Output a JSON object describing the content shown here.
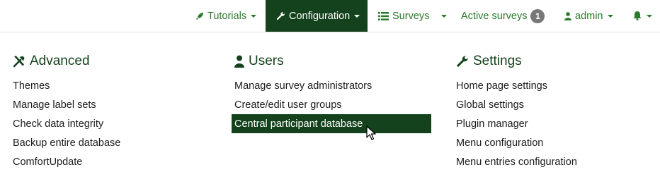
{
  "navbar": {
    "tutorials": {
      "label": "Tutorials",
      "icon": "rocket-icon"
    },
    "configuration": {
      "label": "Configuration",
      "icon": "wrench-icon",
      "active": true
    },
    "surveys": {
      "label": "Surveys",
      "icon": "list-icon"
    },
    "active_surveys": {
      "label": "Active surveys",
      "count": "1"
    },
    "admin": {
      "label": "admin",
      "icon": "user-icon"
    },
    "notifications": {
      "icon": "bell-icon"
    }
  },
  "dropdown": {
    "advanced": {
      "title": "Advanced",
      "icon": "tools-icon",
      "items": [
        "Themes",
        "Manage label sets",
        "Check data integrity",
        "Backup entire database",
        "ComfortUpdate"
      ]
    },
    "users": {
      "title": "Users",
      "icon": "user-icon",
      "items": [
        "Manage survey administrators",
        "Create/edit user groups",
        "Central participant database"
      ],
      "highlighted_index": 2
    },
    "settings": {
      "title": "Settings",
      "icon": "wrench-icon",
      "items": [
        "Home page settings",
        "Global settings",
        "Plugin manager",
        "Menu configuration",
        "Menu entries configuration"
      ]
    }
  },
  "colors": {
    "brand_dark": "#14421c",
    "link_green": "#2c7a2c",
    "badge_gray": "#777777"
  }
}
